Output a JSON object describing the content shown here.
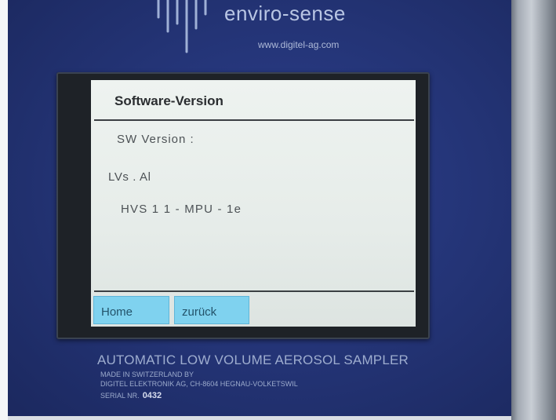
{
  "device": {
    "brand": "enviro-sense",
    "website": "www.digitel-ag.com",
    "panel_color": "#233374"
  },
  "screen": {
    "title": "Software-Version",
    "label": "SW  Version :",
    "values": [
      "LVs . Al",
      "HVS 1 1 - MPU - 1e"
    ],
    "softkeys": {
      "home": "Home",
      "back": "zurück"
    },
    "softkey_color": "#7fd2ef"
  },
  "footer": {
    "product": "AUTOMATIC LOW VOLUME AEROSOL SAMPLER",
    "made_in": "MADE IN SWITZERLAND BY",
    "maker": "DIGITEL ELEKTRONIK AG, CH-8604 HEGNAU-VOLKETSWIL",
    "serial_label": "SERIAL NR.",
    "serial_number": "0432"
  }
}
